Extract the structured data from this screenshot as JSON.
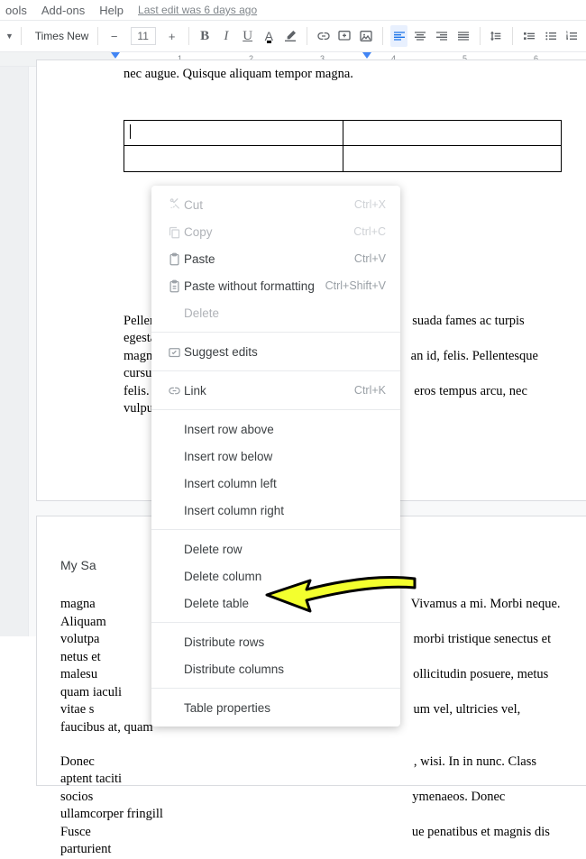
{
  "menubar": {
    "items": [
      "ools",
      "Add-ons",
      "Help"
    ],
    "status": "Last edit was 6 days ago"
  },
  "toolbar": {
    "font_name": "Times New…",
    "font_size": "11",
    "minus": "−",
    "plus": "+",
    "bold": "B",
    "italic": "I",
    "underline": "U",
    "textcolor": "A"
  },
  "ruler": {
    "numbers": [
      "1",
      "2",
      "3",
      "4",
      "5",
      "6"
    ]
  },
  "doc": {
    "intro": "nec augue. Quisque aliquam tempor magna.",
    "para2a": "Pellent",
    "para2b": "suada fames ac turpis egestas. Nunc a",
    "para3a": "magna",
    "para3b": "an id, felis. Pellentesque cursus sagitt",
    "para4a": "felis. P",
    "para4b": "eros tempus arcu, nec vulputate augue",
    "heading": "My Sa",
    "b1a": "magna",
    "b1b": "Vivamus a mi. Morbi neque. Aliquam",
    "b2a": "volutpa",
    "b2b": "morbi tristique senectus et netus et",
    "b3a": "malesu",
    "b3b": "ollicitudin posuere, metus quam iaculi",
    "b4a": "vitae s",
    "b4b": "um vel, ultricies vel, faucibus at, quam",
    "c1a": "Donec",
    "c1b": ", wisi. In in nunc. Class aptent taciti",
    "c2a": "socios",
    "c2b": "ymenaeos. Donec ullamcorper fringill",
    "c3a": "Fusce",
    "c3b": "ue penatibus et magnis dis parturient"
  },
  "ctx": {
    "cut": "Cut",
    "cut_sc": "Ctrl+X",
    "copy": "Copy",
    "copy_sc": "Ctrl+C",
    "paste": "Paste",
    "paste_sc": "Ctrl+V",
    "paste_plain": "Paste without formatting",
    "paste_plain_sc": "Ctrl+Shift+V",
    "delete": "Delete",
    "suggest": "Suggest edits",
    "link": "Link",
    "link_sc": "Ctrl+K",
    "irow_above": "Insert row above",
    "irow_below": "Insert row below",
    "icol_left": "Insert column left",
    "icol_right": "Insert column right",
    "drow": "Delete row",
    "dcol": "Delete column",
    "dtable": "Delete table",
    "dist_rows": "Distribute rows",
    "dist_cols": "Distribute columns",
    "tprops": "Table properties"
  }
}
